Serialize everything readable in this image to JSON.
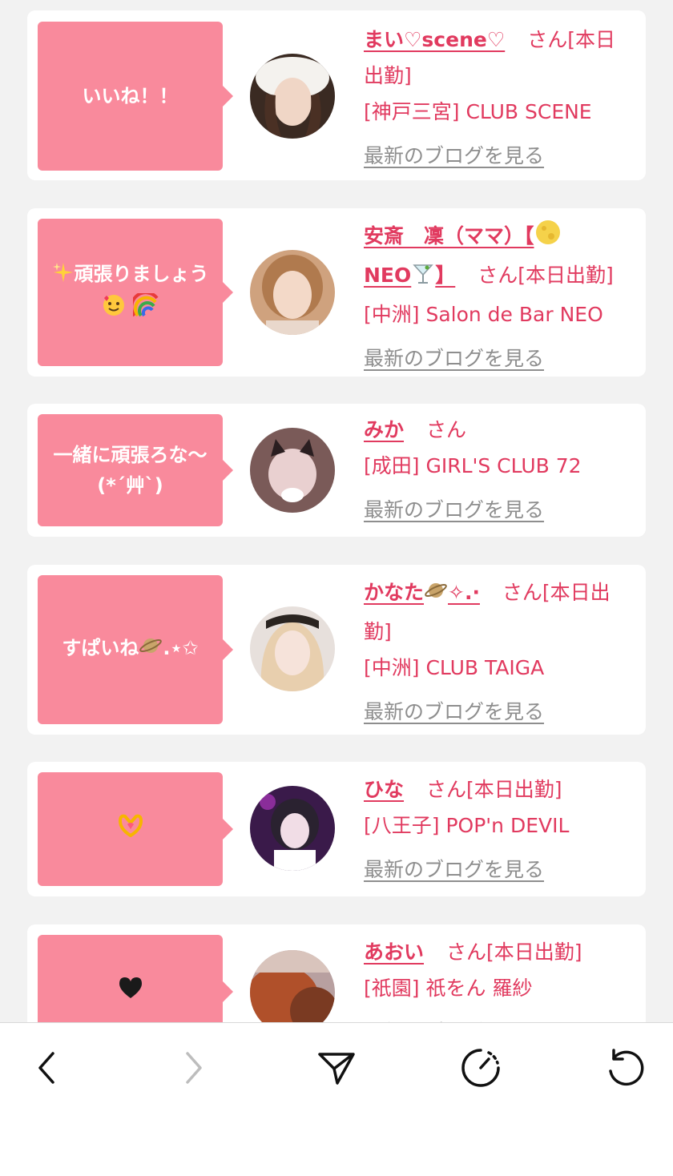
{
  "colors": {
    "accent": "#e13a5f",
    "bubble": "#f98a9c",
    "link_gray": "#8e8e8e",
    "background": "#f2f2f2"
  },
  "cards": [
    {
      "message": "いいね！！",
      "name": "まい♡scene♡",
      "suffix": "さん[本日出勤]",
      "store": "[神戸三宮] CLUB SCENE",
      "blog_link": "最新のブログを見る"
    },
    {
      "message_icon_leading": "sparkles-emoji",
      "message": "頑張りましょう",
      "message_icons_trailing": [
        "smiling-face-hearts-emoji",
        "rainbow-emoji"
      ],
      "name": "安斎　凜（ママ）【",
      "name_icon_mid": "moon-emoji",
      "name_line2": "NEO",
      "name_icon_end": "cocktail-emoji",
      "name_close": "】",
      "suffix": "さん[本日出勤]",
      "store": "[中洲] Salon de Bar NEO",
      "blog_link": "最新のブログを見る"
    },
    {
      "message": "一緒に頑張ろな〜",
      "message_line2": "(*´艸`)",
      "name": "みか",
      "suffix": "さん",
      "store": "[成田] GIRL'S CLUB 72",
      "blog_link": "最新のブログを見る"
    },
    {
      "message": "すぱいね",
      "message_icon_trailing": "ringed-planet-emoji",
      "message_tail": ".⋆✩",
      "name": "かなた",
      "name_icon": "ringed-planet-emoji",
      "name_tail": "✧.·",
      "suffix": "さん[本日出勤]",
      "store": "[中洲] CLUB TAIGA",
      "blog_link": "最新のブログを見る"
    },
    {
      "message_icon": "heart-hands-emoji",
      "name": "ひな",
      "suffix": "さん[本日出勤]",
      "store": "[八王子] POP'n DEVIL",
      "blog_link": "最新のブログを見る"
    },
    {
      "message_icon": "black-heart-emoji",
      "name": "あおい",
      "suffix": "さん[本日出勤]",
      "store": "[祇園] 祇をん 羅紗",
      "blog_link": "最新のブログを見る"
    }
  ],
  "toolbar": {
    "back_icon": "chevron-left-icon",
    "forward_icon": "chevron-right-icon",
    "share_icon": "send-icon",
    "history_icon": "timer-icon",
    "reload_icon": "reload-icon"
  }
}
